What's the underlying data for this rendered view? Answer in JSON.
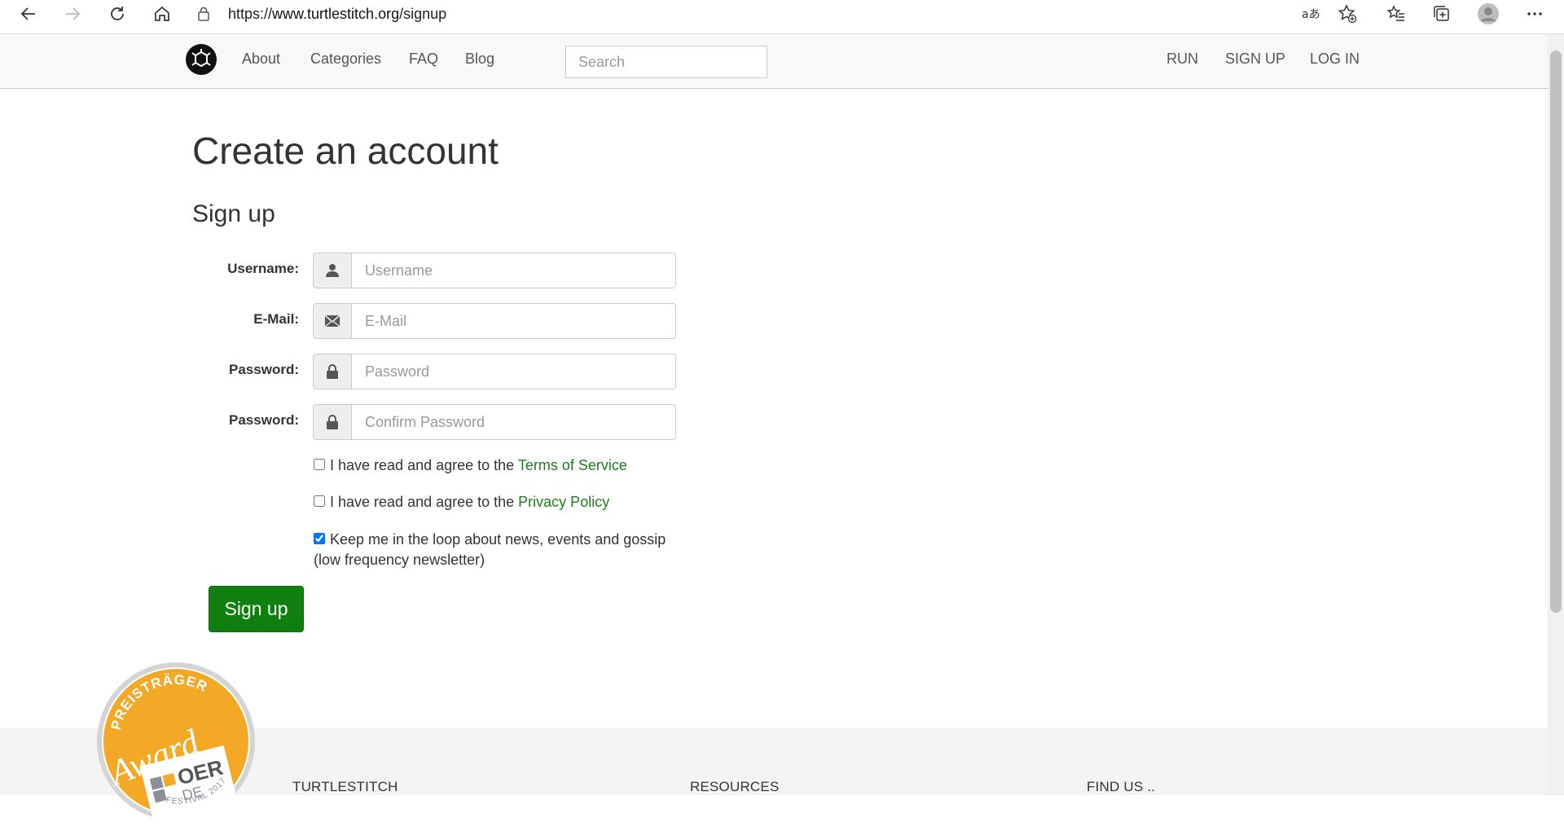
{
  "browser": {
    "url_prefix": "https://",
    "url_host": "www.turtlestitch.org",
    "url_path": "/signup"
  },
  "navbar": {
    "links": [
      "About",
      "Categories",
      "FAQ",
      "Blog"
    ],
    "search_placeholder": "Search",
    "right_links": [
      "RUN",
      "SIGN UP",
      "LOG IN"
    ]
  },
  "main": {
    "title": "Create an account",
    "form_heading": "Sign up",
    "fields": [
      {
        "label": "Username:",
        "placeholder": "Username",
        "icon": "user-icon"
      },
      {
        "label": "E-Mail:",
        "placeholder": "E-Mail",
        "icon": "envelope-icon"
      },
      {
        "label": "Password:",
        "placeholder": "Password",
        "icon": "lock-icon"
      },
      {
        "label": "Password:",
        "placeholder": "Confirm Password",
        "icon": "lock-icon"
      }
    ],
    "checkboxes": [
      {
        "text": "I have read and agree to the ",
        "link": "Terms of Service",
        "checked": false
      },
      {
        "text": "I have read and agree to the ",
        "link": "Privacy Policy",
        "checked": false
      },
      {
        "text": "Keep me in the loop about news, events and gossip",
        "text2": "(low frequency newsletter)",
        "checked": true
      }
    ],
    "submit_label": "Sign up"
  },
  "award": {
    "top_text": "PREISTRÄGER",
    "script_text": "Award",
    "logo_text": "OER",
    "logo_sub": "DE",
    "festival_text": "FESTIVAL 2017"
  },
  "footer": {
    "columns": [
      "TURTLESTITCH",
      "RESOURCES",
      "FIND US .."
    ]
  },
  "colors": {
    "accent_green": "#0f7f0f",
    "link_green": "#1d7f1d",
    "award_orange": "#f3a926"
  }
}
